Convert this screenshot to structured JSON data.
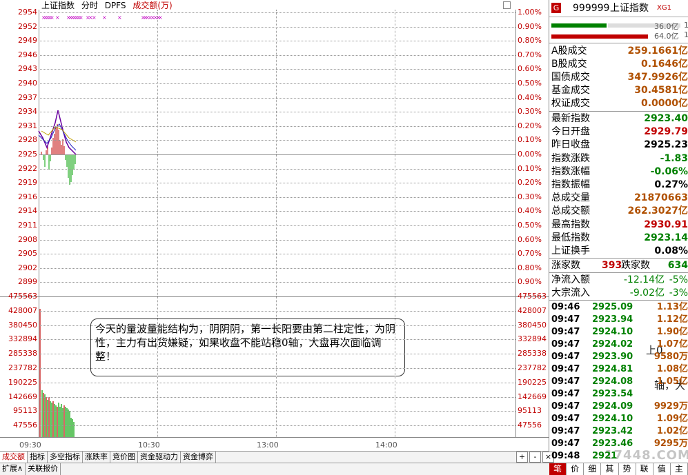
{
  "chart": {
    "title": "上证指数",
    "period": "分时",
    "indicator": "DPFS",
    "volume_label": "成交额(万)",
    "price_labels": [
      "2954",
      "2952",
      "2949",
      "2946",
      "2943",
      "2940",
      "2937",
      "2934",
      "2931",
      "2928",
      "2925",
      "2922",
      "2919",
      "2916",
      "2914",
      "2911",
      "2908",
      "2905",
      "2902",
      "2899"
    ],
    "pct_labels": [
      "1.00%",
      "0.90%",
      "0.80%",
      "0.70%",
      "0.60%",
      "0.50%",
      "0.40%",
      "0.30%",
      "0.20%",
      "0.10%",
      "0.00%",
      "0.10%",
      "0.20%",
      "0.30%",
      "0.40%",
      "0.50%",
      "0.60%",
      "0.70%",
      "0.80%",
      "0.90%"
    ],
    "vol_labels": [
      "475563",
      "428007",
      "380450",
      "332894",
      "285338",
      "237782",
      "190225",
      "142669",
      "95113",
      "47556"
    ],
    "time_labels": [
      "09:30",
      "10:30",
      "13:00",
      "14:00"
    ],
    "colors": {
      "up": "#c00000",
      "down": "#00a000",
      "price": "#6a00a0",
      "avg": "#c0a000",
      "marker": "#c000c0"
    }
  },
  "callout": {
    "text": "今天的量波量能结构为，阴阴阴，第一长阳要由第二柱定性，为阴性，主力有出货嫌疑，如果收盘不能站稳0轴，大盘再次面临调整！"
  },
  "bottom_tabs": [
    "成交额",
    "指标",
    "多空指标",
    "涨跌率",
    "竞价图",
    "资金驱动力",
    "资金博弈"
  ],
  "bottom_tabs2": [
    "扩展∧",
    "关联报价"
  ],
  "nav_buttons": [
    "+",
    "-",
    "×"
  ],
  "panel": {
    "badge": "G",
    "code": "999999",
    "name": "上证指数",
    "tag": "XG1",
    "bar_top_value": "36.0亿",
    "bar_bottom_value": "64.0亿",
    "bar_top_suffix": "1",
    "bar_bottom_suffix": "1",
    "turnover_rows": [
      {
        "k": "A股成交",
        "v": "259.1661亿"
      },
      {
        "k": "B股成交",
        "v": "0.1646亿"
      },
      {
        "k": "国债成交",
        "v": "347.9926亿"
      },
      {
        "k": "基金成交",
        "v": "30.4581亿"
      },
      {
        "k": "权证成交",
        "v": "0.0000亿"
      }
    ],
    "index_rows": [
      {
        "k": "最新指数",
        "v": "2923.40",
        "c": "#008000"
      },
      {
        "k": "今日开盘",
        "v": "2929.79",
        "c": "#c00000"
      },
      {
        "k": "昨日收盘",
        "v": "2925.23",
        "c": "#000000"
      },
      {
        "k": "指数涨跌",
        "v": "-1.83",
        "c": "#008000"
      },
      {
        "k": "指数涨幅",
        "v": "-0.06%",
        "c": "#008000"
      },
      {
        "k": "指数振幅",
        "v": "0.27%",
        "c": "#000000"
      },
      {
        "k": "总成交量",
        "v": "21870663",
        "c": "#b05000"
      },
      {
        "k": "总成交额",
        "v": "262.3027亿",
        "c": "#b05000"
      },
      {
        "k": "最高指数",
        "v": "2930.91",
        "c": "#c00000"
      },
      {
        "k": "最低指数",
        "v": "2923.14",
        "c": "#008000"
      },
      {
        "k": "上证换手",
        "v": "0.08%",
        "c": "#000000"
      }
    ],
    "up_label": "涨家数",
    "up_count": "393",
    "down_label": "跌家数",
    "down_count": "634",
    "flow_rows": [
      {
        "k": "净流入额",
        "v": "-12.14亿",
        "p": "-5%"
      },
      {
        "k": "大宗流入",
        "v": "-9.02亿",
        "p": "-3%"
      }
    ],
    "ticks": [
      {
        "t": "09:46",
        "p": "2925.09",
        "v": "1.13亿"
      },
      {
        "t": "09:47",
        "p": "2923.94",
        "v": "1.12亿"
      },
      {
        "t": "09:47",
        "p": "2924.10",
        "v": "1.90亿"
      },
      {
        "t": "09:47",
        "p": "2924.02",
        "v": "1.07亿"
      },
      {
        "t": "09:47",
        "p": "2923.90",
        "v": "9580万"
      },
      {
        "t": "09:47",
        "p": "2924.81",
        "v": "1.08亿"
      },
      {
        "t": "09:47",
        "p": "2924.08",
        "v": "1.05亿"
      },
      {
        "t": "09:47",
        "p": "2923.54",
        "v": ""
      },
      {
        "t": "09:47",
        "p": "2924.09",
        "v": "9929万"
      },
      {
        "t": "09:47",
        "p": "2924.10",
        "v": "1.09亿"
      },
      {
        "t": "09:47",
        "p": "2923.42",
        "v": "1.02亿"
      },
      {
        "t": "09:47",
        "p": "2923.46",
        "v": "9295万"
      },
      {
        "t": "09:48",
        "p": "2921",
        "v": ""
      }
    ],
    "overlay_text_1": "上0",
    "overlay_text_2": "轴，大",
    "watermark": "17448.COM",
    "bottom_tabs": [
      "笔",
      "价",
      "细",
      "其",
      "势",
      "联",
      "值",
      "主"
    ]
  }
}
